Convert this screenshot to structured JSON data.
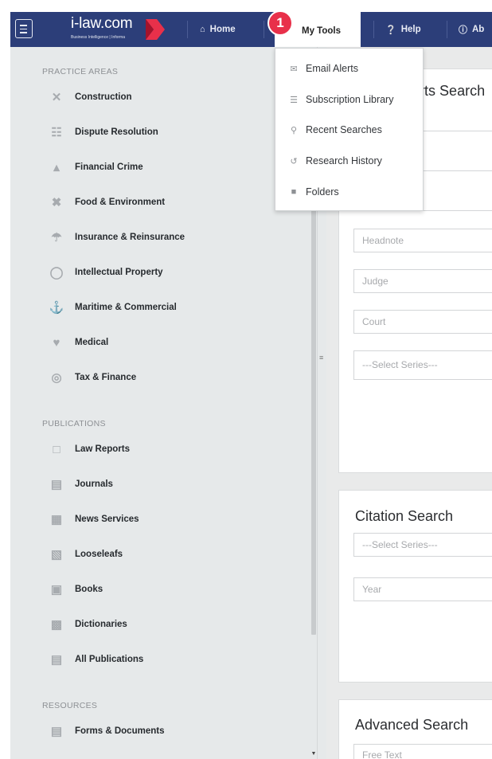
{
  "header": {
    "logo_text": "i-law.com",
    "logo_sub": "Business Intelligence | Informa",
    "nav": [
      {
        "label": "Home",
        "icon": "home-icon"
      },
      {
        "label": "My Tools",
        "icon": ""
      },
      {
        "label": "Help",
        "icon": "help-icon"
      },
      {
        "label": "Ab",
        "icon": "info-icon"
      }
    ],
    "badge": "1"
  },
  "dropdown": {
    "items": [
      {
        "label": "Email Alerts",
        "icon": "email-alert-icon"
      },
      {
        "label": "Subscription Library",
        "icon": "library-icon"
      },
      {
        "label": "Recent Searches",
        "icon": "magnifier-icon"
      },
      {
        "label": "Research History",
        "icon": "history-icon"
      },
      {
        "label": "Folders",
        "icon": "folder-icon"
      }
    ]
  },
  "sidebar": {
    "practice_title": "PRACTICE AREAS",
    "practice_items": [
      {
        "label": "Construction",
        "icon": "tools-icon"
      },
      {
        "label": "Dispute Resolution",
        "icon": "dispute-icon"
      },
      {
        "label": "Financial Crime",
        "icon": "money-bag-icon"
      },
      {
        "label": "Food & Environment",
        "icon": "utensils-icon"
      },
      {
        "label": "Insurance & Reinsurance",
        "icon": "umbrella-icon"
      },
      {
        "label": "Intellectual Property",
        "icon": "lightbulb-icon"
      },
      {
        "label": "Maritime & Commercial",
        "icon": "anchor-icon"
      },
      {
        "label": "Medical",
        "icon": "heart-icon"
      },
      {
        "label": "Tax & Finance",
        "icon": "coins-icon"
      }
    ],
    "publications_title": "PUBLICATIONS",
    "publication_items": [
      {
        "label": "Law Reports",
        "icon": "book-open-icon"
      },
      {
        "label": "Journals",
        "icon": "journal-icon"
      },
      {
        "label": "News Services",
        "icon": "newspaper-icon"
      },
      {
        "label": "Looseleafs",
        "icon": "binder-icon"
      },
      {
        "label": "Books",
        "icon": "book-icon"
      },
      {
        "label": "Dictionaries",
        "icon": "dictionary-icon"
      },
      {
        "label": "All Publications",
        "icon": "publications-icon"
      }
    ],
    "resources_title": "RESOURCES",
    "resource_items": [
      {
        "label": "Forms & Documents",
        "icon": "document-icon"
      }
    ]
  },
  "main": {
    "law_reports_title": "Law Reports Search",
    "headnote_placeholder": "Headnote",
    "judge_placeholder": "Judge",
    "court_placeholder": "Court",
    "series_placeholder": "---Select Series---",
    "citation_title": "Citation Search",
    "citation_series_placeholder": "---Select Series---",
    "year_placeholder": "Year",
    "advanced_title": "Advanced Search",
    "free_text_placeholder": "Free Text"
  },
  "colors": {
    "topbar": "#2c3e79",
    "badge": "#e8304a",
    "sidebar_bg": "#e6e9ea"
  }
}
